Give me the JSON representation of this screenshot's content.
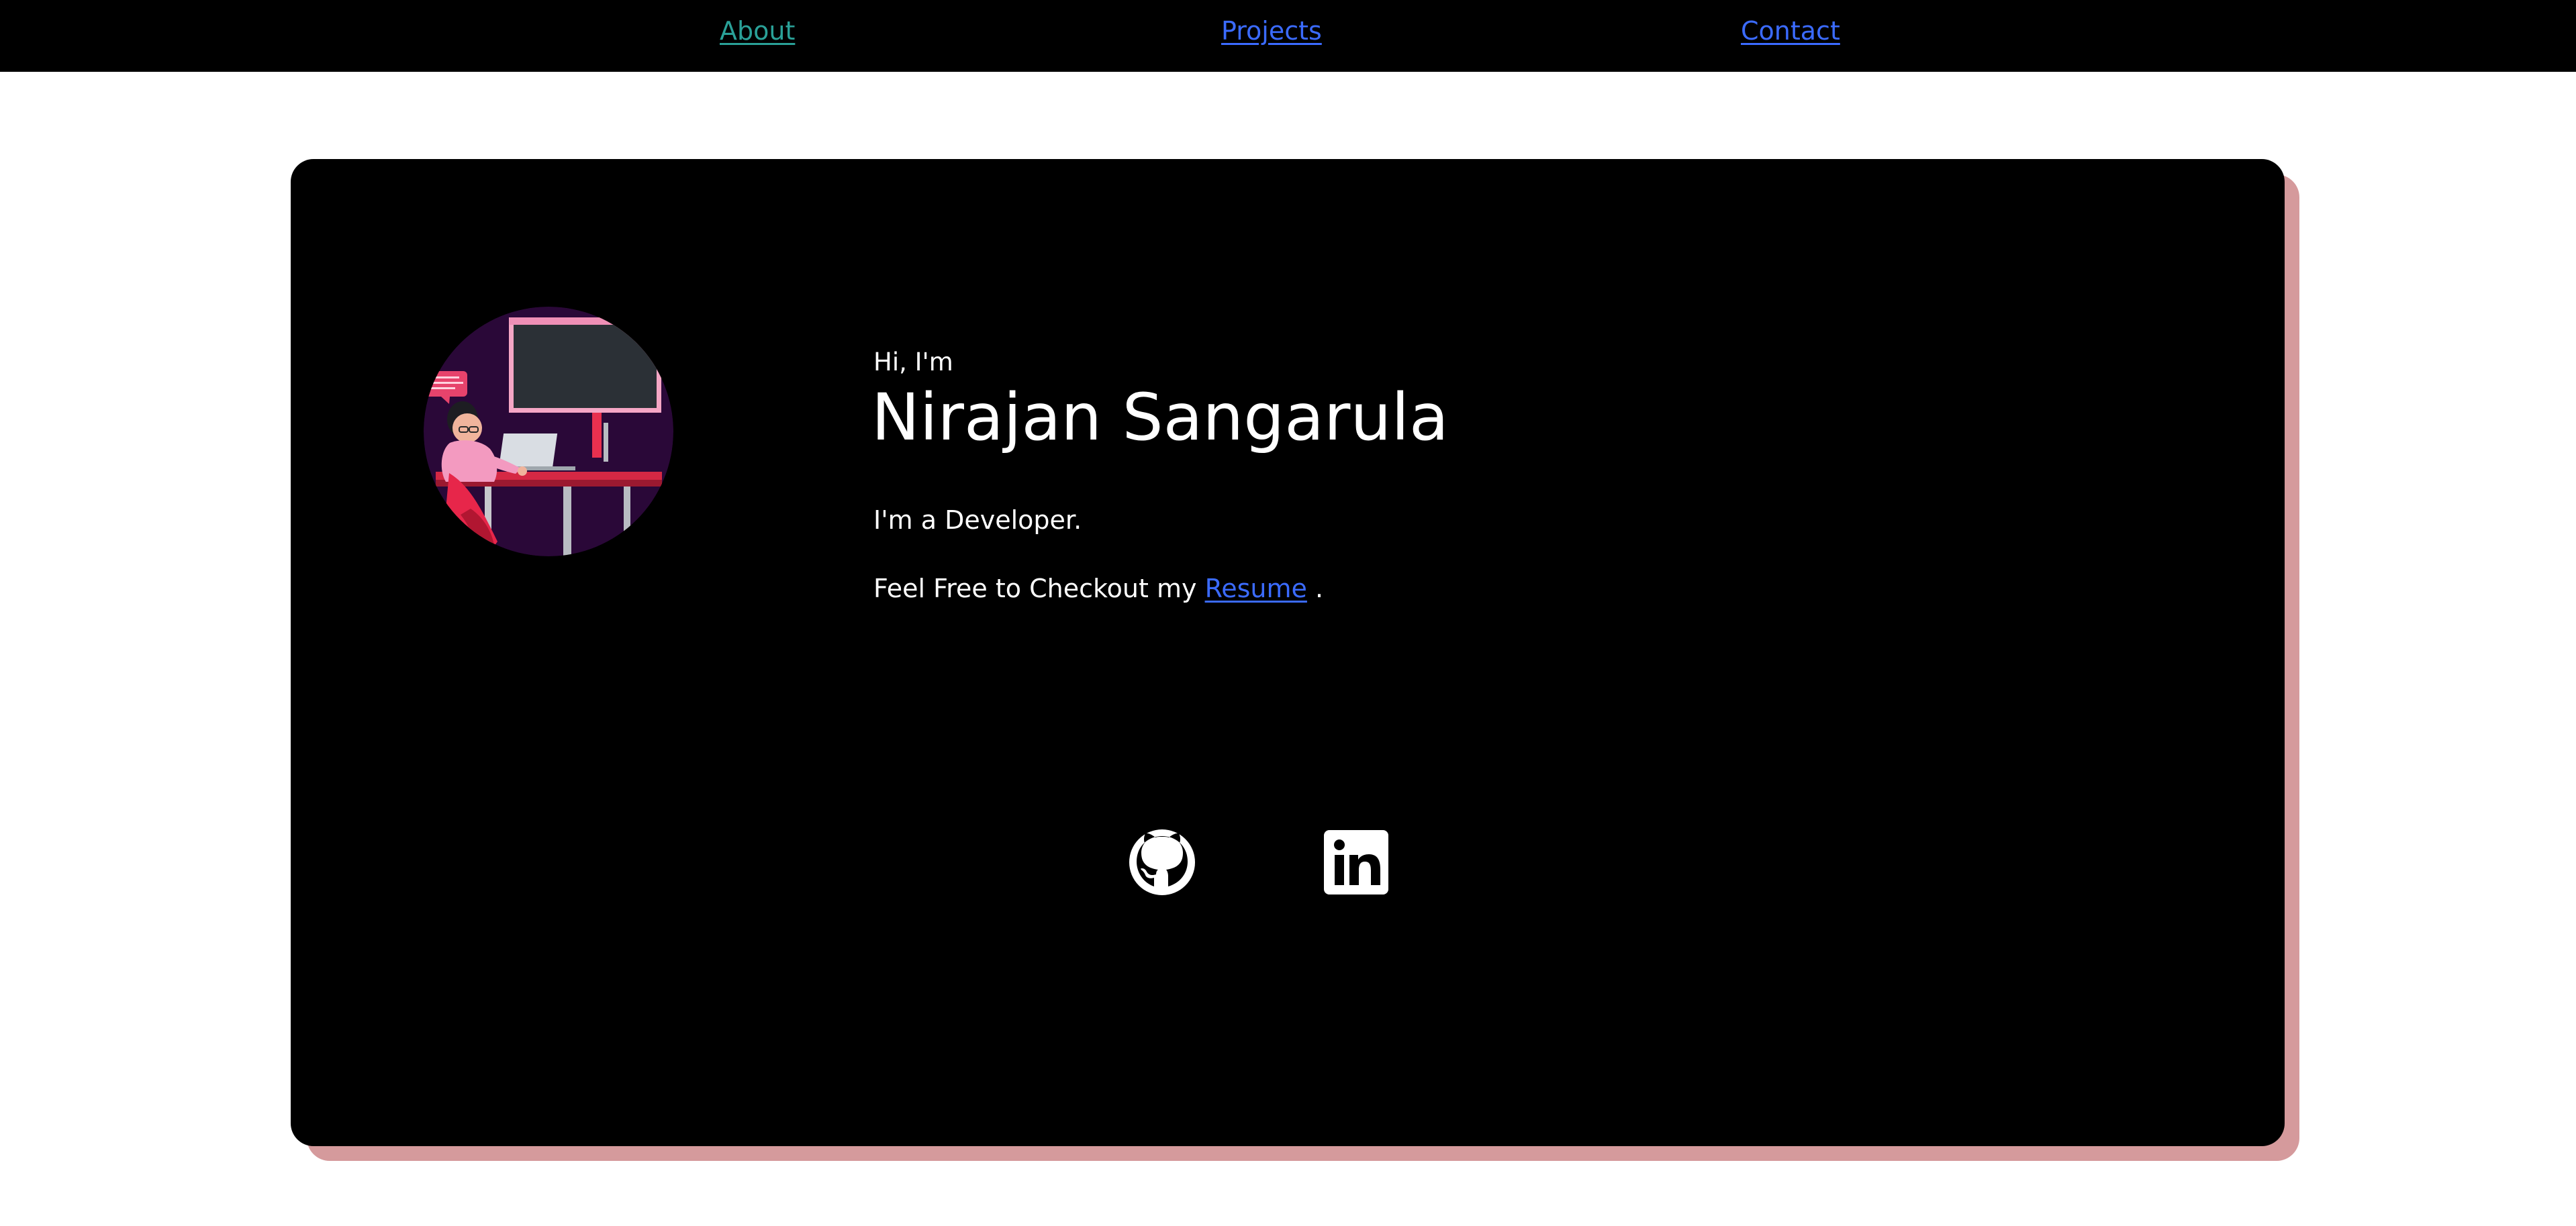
{
  "nav": {
    "about": "About",
    "projects": "Projects",
    "contact": "Contact"
  },
  "hero": {
    "greeting": "Hi, I'm",
    "name": "Nirajan Sangarula",
    "role": "I'm a Developer.",
    "resume_prefix": "Feel Free to Checkout my ",
    "resume_link": "Resume",
    "resume_suffix": " ."
  },
  "avatar": {
    "bubble_text": "",
    "laptop_brand": ""
  },
  "social": [
    {
      "icon": "github-icon"
    },
    {
      "icon": "linkedin-icon"
    }
  ],
  "colors": {
    "nav_background": "#000000",
    "card_background": "#000000",
    "card_shadow": "#d59a9c",
    "visited_link": "#2aa198",
    "link": "#3b6bff",
    "text": "#ffffff"
  }
}
